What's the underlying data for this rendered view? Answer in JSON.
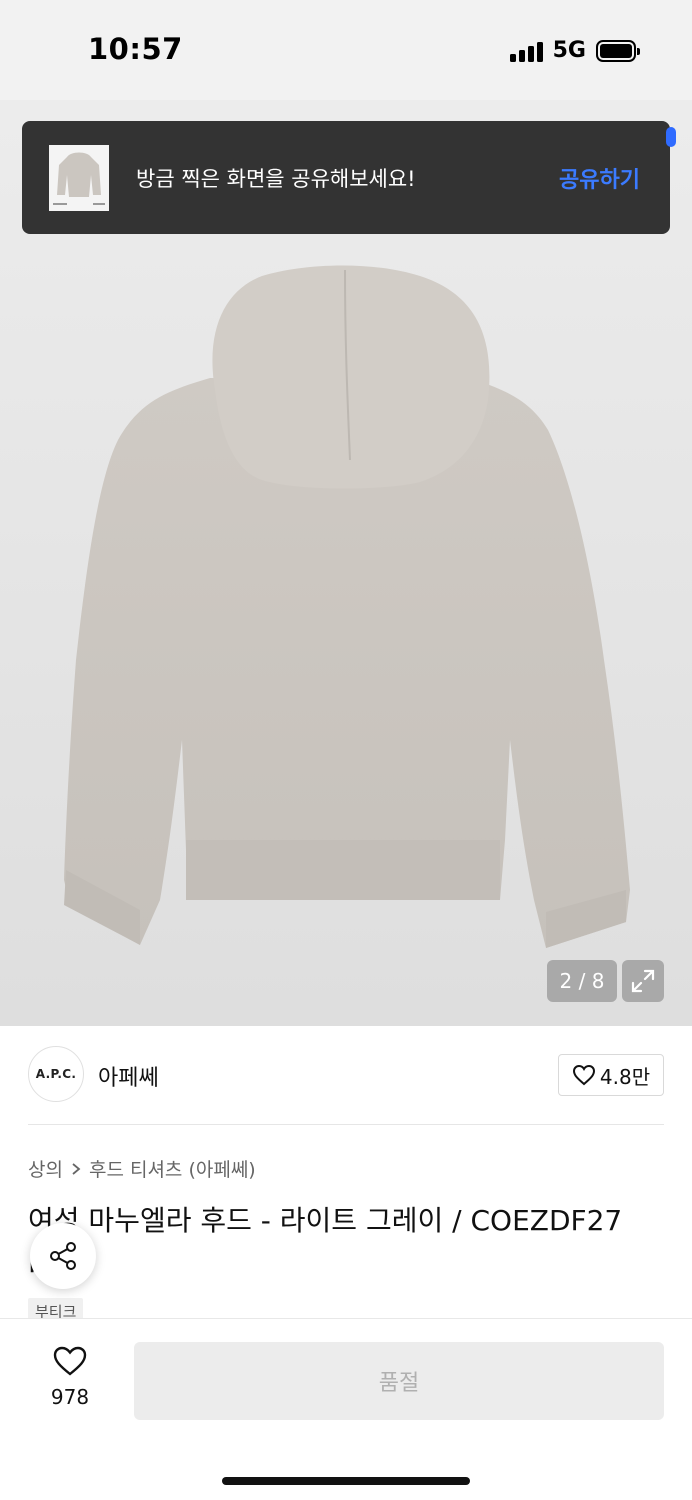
{
  "status_bar": {
    "time": "10:57",
    "network": "5G"
  },
  "toast": {
    "message": "방금 찍은 화면을 공유해보세요!",
    "action": "공유하기"
  },
  "gallery": {
    "counter": "2 / 8"
  },
  "brand": {
    "logo_text": "A.P.C.",
    "name": "아페쎄",
    "likes": "4.8만"
  },
  "breadcrumb": {
    "category": "상의",
    "separator": ">",
    "subcategory": "후드 티셔츠 (아페쎄)"
  },
  "product": {
    "title": "여성 마누엘라 후드 - 라이트 그레이 / COEZDF27 PAA",
    "tag": "부티크"
  },
  "bottom_bar": {
    "wish_count": "978",
    "buy_label": "품절"
  },
  "colors": {
    "toast_bg": "#333333",
    "toast_action": "#3b7bff",
    "sold_out_bg": "#ececec",
    "sold_out_text": "#b0b0b0"
  },
  "icons": [
    "signal-icon",
    "battery-icon",
    "expand-icon",
    "heart-icon",
    "share-icon",
    "chevron-right-icon"
  ]
}
